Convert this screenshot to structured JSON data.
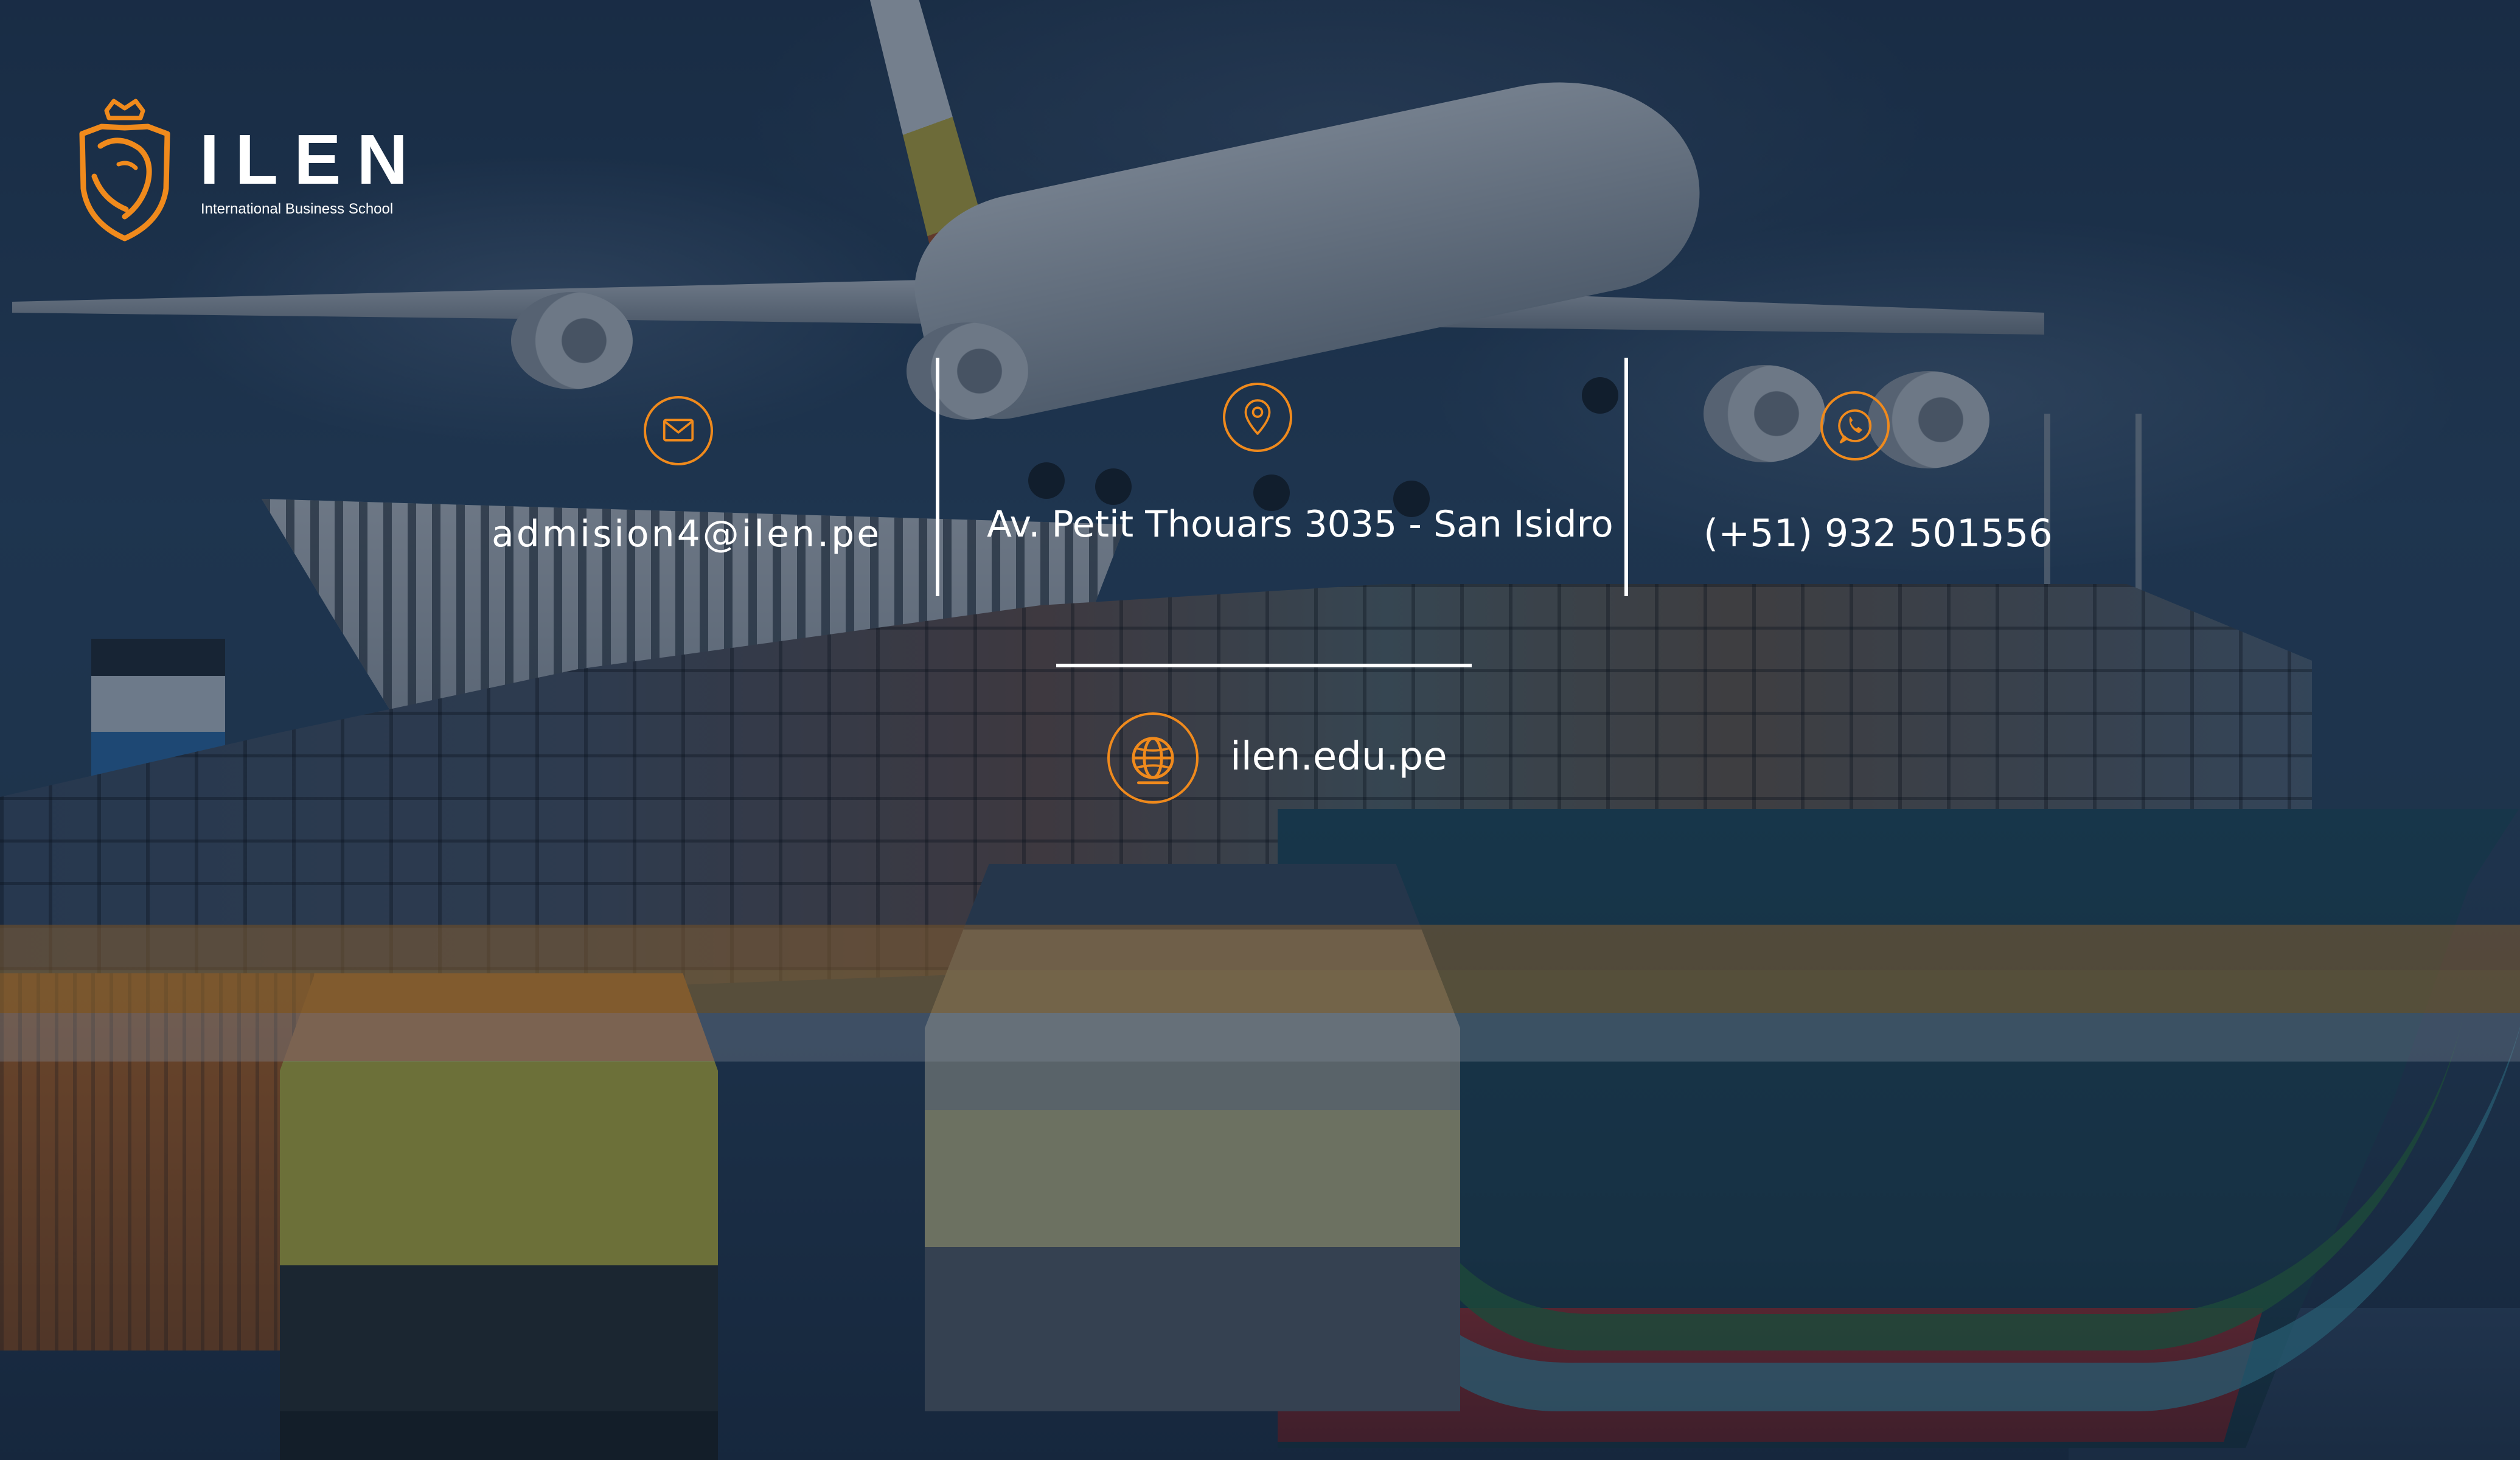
{
  "colors": {
    "accent": "#f08a1c",
    "text": "#ffffff",
    "overlay": "#122238"
  },
  "logo": {
    "name": "ILEN",
    "subtitle": "International Business School",
    "icon": "lion-crest-icon"
  },
  "contacts": {
    "email": {
      "icon": "mail-icon",
      "value": "admision4@ilen.pe"
    },
    "address": {
      "icon": "location-pin-icon",
      "value": "Av. Petit Thouars 3035 - San Isidro"
    },
    "phone": {
      "icon": "whatsapp-icon",
      "value": "(+51) 932 501556"
    },
    "website": {
      "icon": "globe-icon",
      "value": "ilen.edu.pe"
    }
  }
}
